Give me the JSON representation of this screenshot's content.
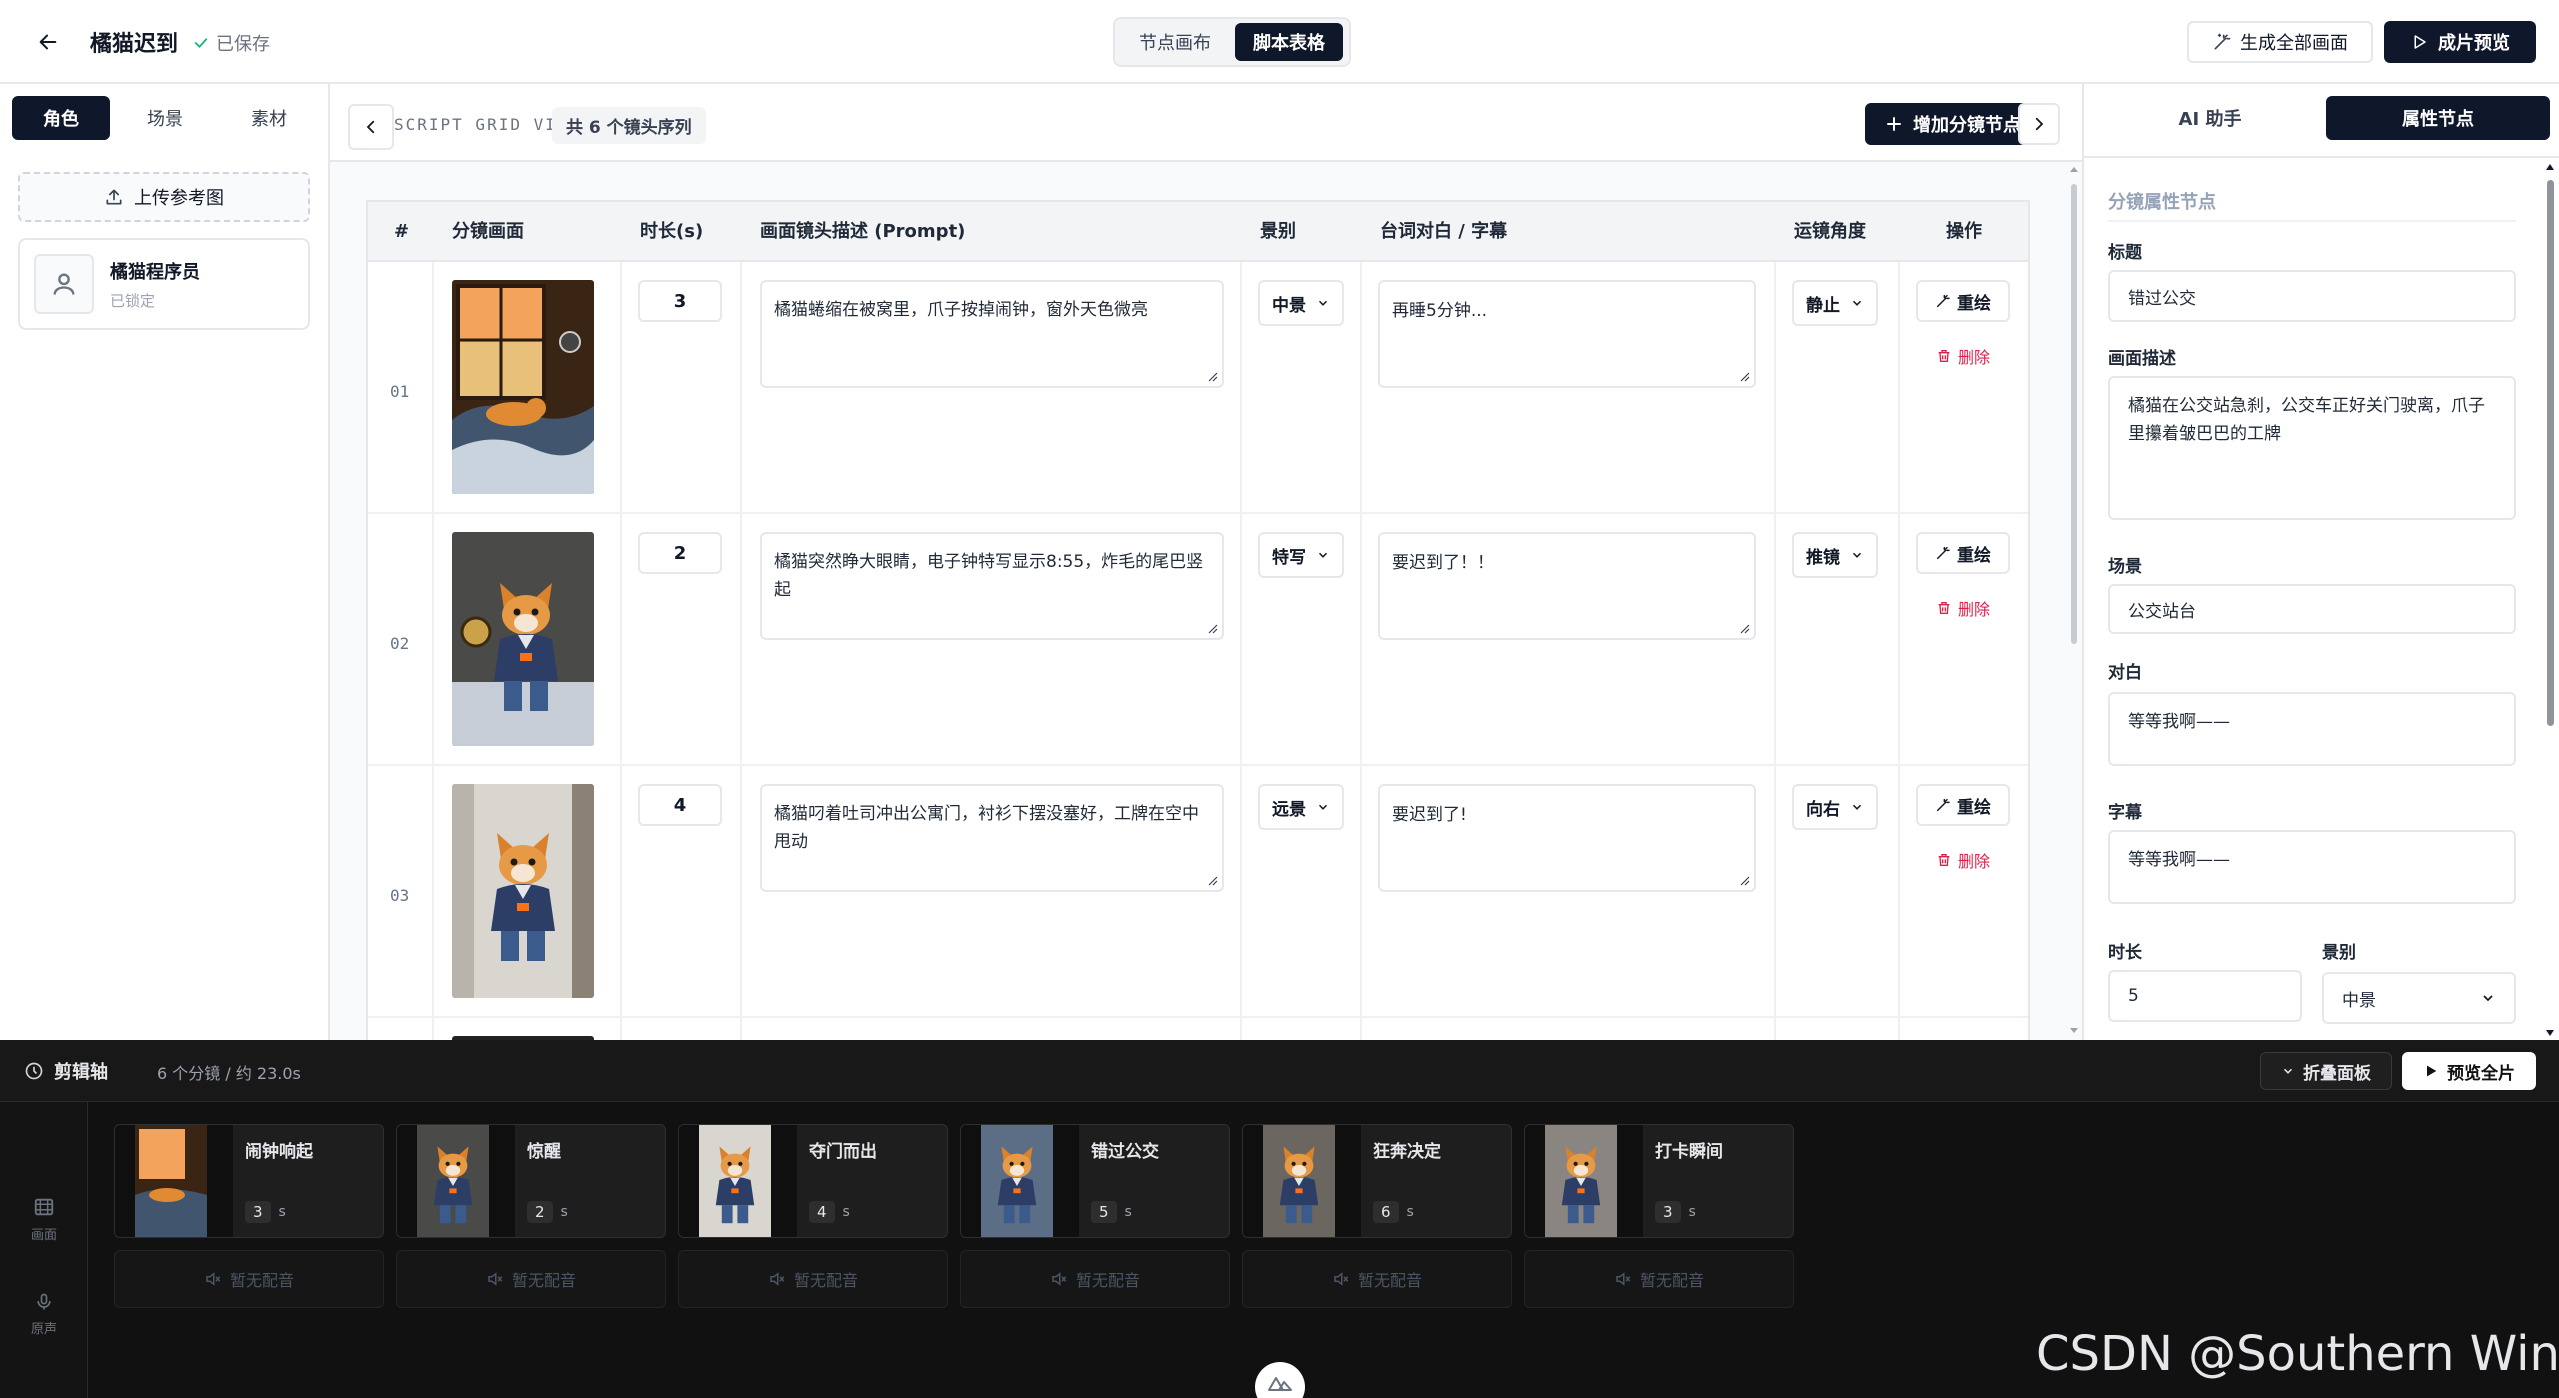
{
  "header": {
    "project_title": "橘猫迟到",
    "saved_status": "已保存",
    "view_tabs": [
      "节点画布",
      "脚本表格"
    ],
    "generate_all_label": "生成全部画面",
    "preview_label": "成片预览"
  },
  "left_panel": {
    "tabs": [
      "角色",
      "场景",
      "素材"
    ],
    "upload_label": "上传参考图",
    "character": {
      "name": "橘猫程序员",
      "status": "已锁定"
    }
  },
  "center": {
    "grid_label": "SCRIPT GRID VIEW",
    "count_label": "共 6 个镜头序列",
    "add_node_label": "增加分镜节点",
    "columns": [
      "#",
      "分镜画面",
      "时长(s)",
      "画面镜头描述 (Prompt)",
      "景别",
      "台词对白 / 字幕",
      "运镜角度",
      "操作"
    ],
    "redraw_label": "重绘",
    "delete_label": "删除",
    "rows": [
      {
        "num": "01",
        "duration": "3",
        "prompt": "橘猫蜷缩在被窝里，爪子按掉闹钟，窗外天色微亮",
        "shot": "中景",
        "dialog": "再睡5分钟...",
        "angle": "静止"
      },
      {
        "num": "02",
        "duration": "2",
        "prompt": "橘猫突然睁大眼睛，电子钟特写显示8:55，炸毛的尾巴竖起",
        "shot": "特写",
        "dialog": "要迟到了！！",
        "angle": "推镜"
      },
      {
        "num": "03",
        "duration": "4",
        "prompt": "橘猫叼着吐司冲出公寓门，衬衫下摆没塞好，工牌在空中甩动",
        "shot": "远景",
        "dialog": "要迟到了!",
        "angle": "向右"
      }
    ]
  },
  "right_panel": {
    "tabs": [
      "AI 助手",
      "属性节点"
    ],
    "section_title": "分镜属性节点",
    "fields": {
      "title_label": "标题",
      "title_value": "错过公交",
      "desc_label": "画面描述",
      "desc_value": "橘猫在公交站急刹，公交车正好关门驶离，爪子里攥着皱巴巴的工牌",
      "scene_label": "场景",
      "scene_value": "公交站台",
      "dialog_label": "对白",
      "dialog_value": "等等我啊——",
      "subtitle_label": "字幕",
      "subtitle_value": "等等我啊——",
      "duration_label": "时长",
      "duration_value": "5",
      "shot_label": "景别",
      "shot_value": "中景"
    }
  },
  "timeline": {
    "title": "剪辑轴",
    "summary": "6 个分镜 / 约 23.0s",
    "fold_label": "折叠面板",
    "play_label": "预览全片",
    "side": {
      "picture": "画面",
      "voice": "原声"
    },
    "unit": "s",
    "no_audio_label": "暂无配音",
    "clips": [
      {
        "name": "闹钟响起",
        "duration": "3"
      },
      {
        "name": "惊醒",
        "duration": "2"
      },
      {
        "name": "夺门而出",
        "duration": "4"
      },
      {
        "name": "错过公交",
        "duration": "5"
      },
      {
        "name": "狂奔决定",
        "duration": "6"
      },
      {
        "name": "打卡瞬间",
        "duration": "3"
      }
    ]
  },
  "watermark": "CSDN @Southern Wind",
  "colors": {
    "primary": "#0f172a",
    "danger": "#e11d48",
    "timeline_bg": "#111111",
    "table_header": "#f3f4f6"
  }
}
